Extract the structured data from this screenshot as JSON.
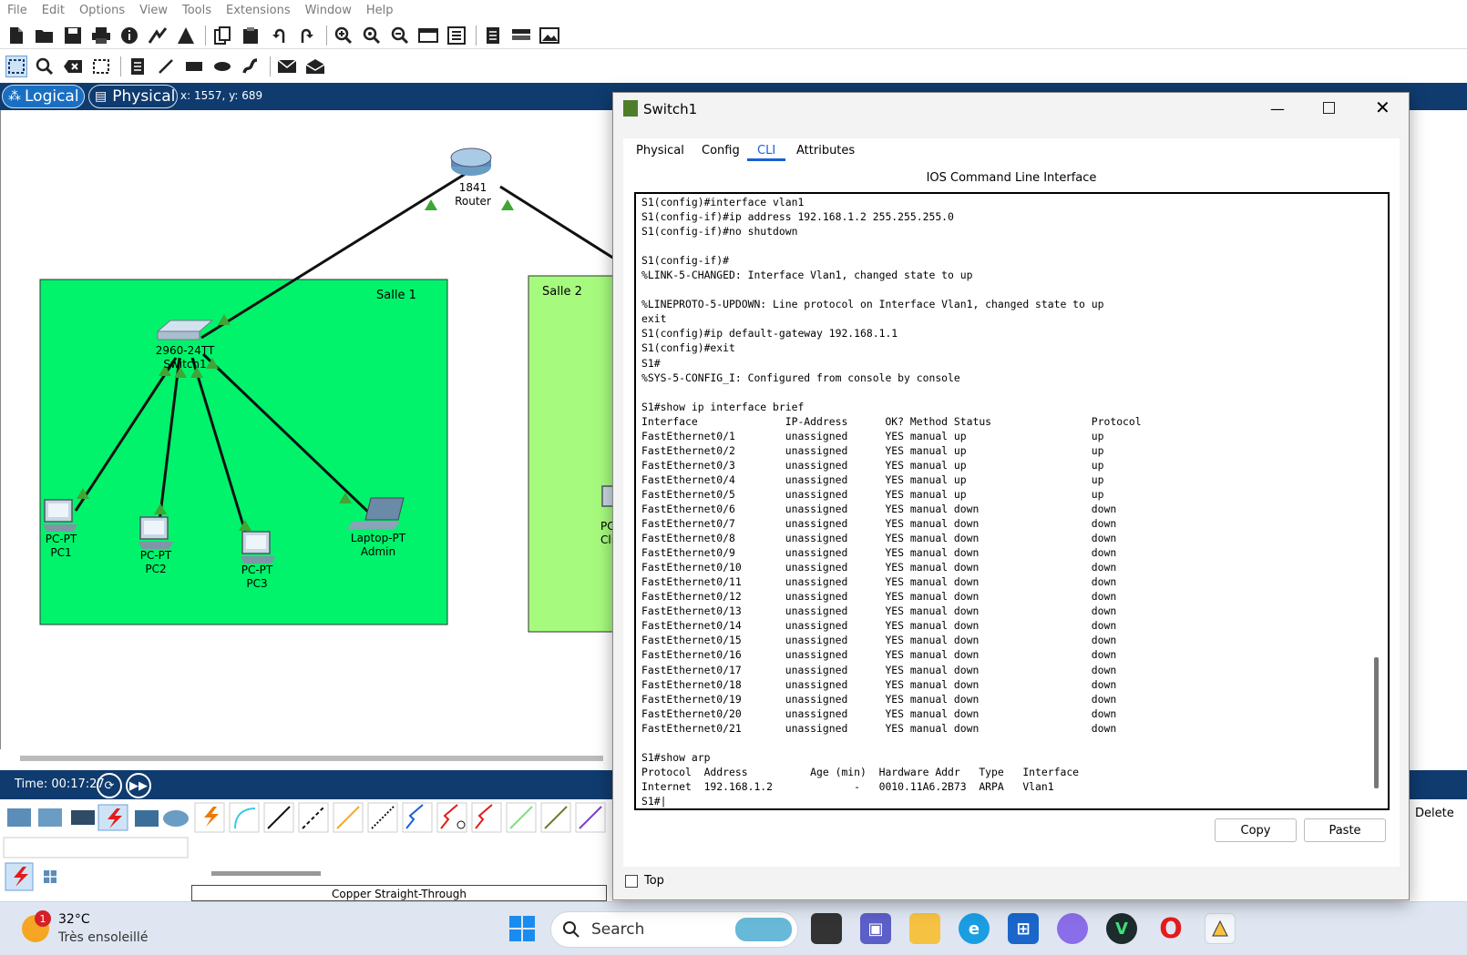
{
  "menubar": {
    "items": [
      "File",
      "Edit",
      "Options",
      "View",
      "Tools",
      "Extensions",
      "Window",
      "Help"
    ]
  },
  "toolbar1": {
    "icons": [
      "new-file-icon",
      "open-folder-icon",
      "save-icon",
      "print-icon",
      "info-icon",
      "network-wizard-icon",
      "activity-wizard-icon",
      "copy-icon",
      "paste-icon",
      "undo-icon",
      "redo-icon",
      "zoom-in-icon",
      "zoom-reset-icon",
      "zoom-out-icon",
      "drawing-palette-icon",
      "custom-devices-icon",
      "pdu-list-icon",
      "cluster-icon",
      "screenshot-icon"
    ]
  },
  "toolbar2": {
    "icons": [
      "select-icon",
      "inspect-icon",
      "delete-icon",
      "resize-icon",
      "note-icon",
      "line-icon",
      "rectangle-icon",
      "ellipse-icon",
      "freeform-icon",
      "simple-pdu-icon",
      "complex-pdu-icon"
    ]
  },
  "modebar": {
    "logical": "Logical",
    "physical": "Physical",
    "coords": "x: 1557, y: 689"
  },
  "workspace": {
    "router": {
      "model": "1841",
      "name": "Router"
    },
    "salle1": "Salle 1",
    "salle2": "Salle 2",
    "switch": {
      "model": "2960-24TT",
      "name": "Switch1"
    },
    "pc1": {
      "type": "PC-PT",
      "name": "PC1"
    },
    "pc2": {
      "type": "PC-PT",
      "name": "PC2"
    },
    "pc3": {
      "type": "PC-PT",
      "name": "PC3"
    },
    "laptop": {
      "type": "Laptop-PT",
      "name": "Admin"
    },
    "salle2_partial": {
      "type": "PC",
      "name": "Cli"
    },
    "colors": {
      "salle1": "#00f36b",
      "salle2": "#a6fb7e",
      "link": "#111111",
      "port_up": "#3fa535"
    }
  },
  "timebar": {
    "time": "Time: 00:17:27"
  },
  "devices": {
    "cable_name": "Copper Straight-Through",
    "delete_label": "Delete"
  },
  "dialog": {
    "title": "Switch1",
    "tabs": [
      "Physical",
      "Config",
      "CLI",
      "Attributes"
    ],
    "active_tab": "CLI",
    "cli_title": "IOS Command Line Interface",
    "copy": "Copy",
    "paste": "Paste",
    "top_checkbox": "Top",
    "lines": [
      "S1(config)#interface vlan1",
      "S1(config-if)#ip address 192.168.1.2 255.255.255.0",
      "S1(config-if)#no shutdown",
      "",
      "S1(config-if)#",
      "%LINK-5-CHANGED: Interface Vlan1, changed state to up",
      "",
      "%LINEPROTO-5-UPDOWN: Line protocol on Interface Vlan1, changed state to up",
      "exit",
      "S1(config)#ip default-gateway 192.168.1.1",
      "S1(config)#exit",
      "S1#",
      "%SYS-5-CONFIG_I: Configured from console by console",
      "",
      "S1#show ip interface brief",
      "Interface              IP-Address      OK? Method Status                Protocol",
      "FastEthernet0/1        unassigned      YES manual up                    up",
      "FastEthernet0/2        unassigned      YES manual up                    up",
      "FastEthernet0/3        unassigned      YES manual up                    up",
      "FastEthernet0/4        unassigned      YES manual up                    up",
      "FastEthernet0/5        unassigned      YES manual up                    up",
      "FastEthernet0/6        unassigned      YES manual down                  down",
      "FastEthernet0/7        unassigned      YES manual down                  down",
      "FastEthernet0/8        unassigned      YES manual down                  down",
      "FastEthernet0/9        unassigned      YES manual down                  down",
      "FastEthernet0/10       unassigned      YES manual down                  down",
      "FastEthernet0/11       unassigned      YES manual down                  down",
      "FastEthernet0/12       unassigned      YES manual down                  down",
      "FastEthernet0/13       unassigned      YES manual down                  down",
      "FastEthernet0/14       unassigned      YES manual down                  down",
      "FastEthernet0/15       unassigned      YES manual down                  down",
      "FastEthernet0/16       unassigned      YES manual down                  down",
      "FastEthernet0/17       unassigned      YES manual down                  down",
      "FastEthernet0/18       unassigned      YES manual down                  down",
      "FastEthernet0/19       unassigned      YES manual down                  down",
      "FastEthernet0/20       unassigned      YES manual down                  down",
      "FastEthernet0/21       unassigned      YES manual down                  down",
      "",
      "S1#show arp",
      "Protocol  Address          Age (min)  Hardware Addr   Type   Interface",
      "Internet  192.168.1.2             -   0010.11A6.2B73  ARPA   Vlan1",
      "S1#"
    ]
  },
  "taskbar": {
    "weather_temp": "32°C",
    "weather_desc": "Très ensoleillé",
    "weather_badge": "1",
    "search_placeholder": "Search",
    "apps": [
      "windows-start-icon",
      "file-explorer-icon",
      "teams-icon",
      "folder-icon",
      "edge-icon",
      "store-icon",
      "copilot-icon",
      "vpn-icon",
      "opera-icon",
      "packet-tracer-icon"
    ]
  }
}
